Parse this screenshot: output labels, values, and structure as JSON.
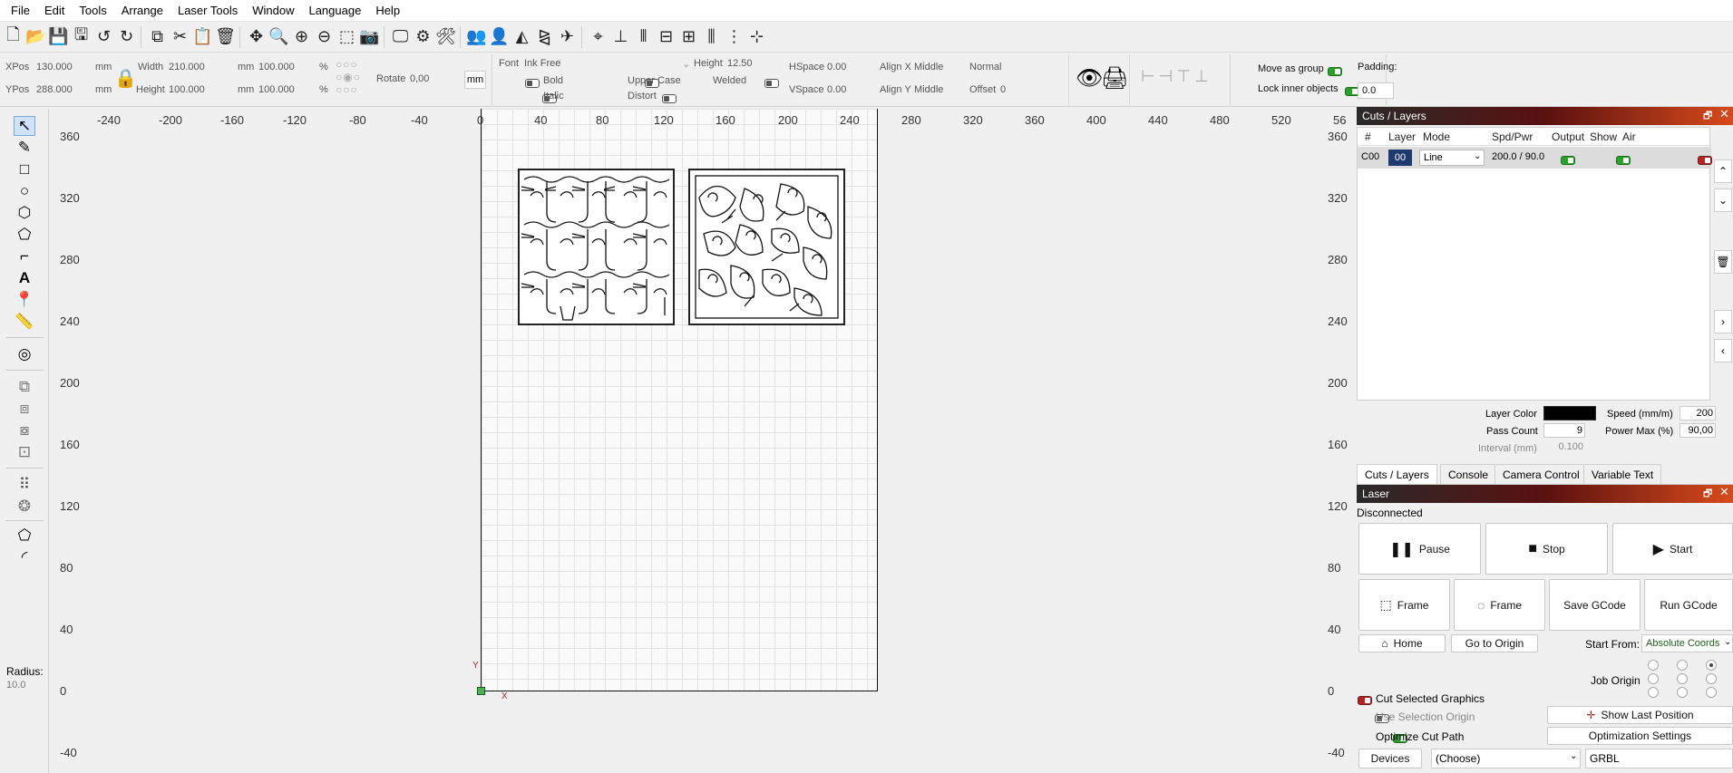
{
  "menu": [
    "File",
    "Edit",
    "Tools",
    "Arrange",
    "Laser Tools",
    "Window",
    "Language",
    "Help"
  ],
  "toolbar_icons": [
    "new-file-icon",
    "open-file-icon",
    "save-icon",
    "save-as-icon",
    "undo-icon",
    "redo-icon",
    "copy-icon",
    "cut-icon",
    "paste-icon",
    "delete-icon",
    "move-icon",
    "zoom-fit-icon",
    "zoom-in-icon",
    "zoom-out-icon",
    "select-frame-icon",
    "camera-icon",
    "monitor-icon",
    "settings-icon",
    "tools-icon",
    "group-icon",
    "user-icon",
    "mirror-icon",
    "flip-icon",
    "send-icon",
    "target-icon",
    "align-bottom-icon",
    "distribute-icon",
    "align-middle-icon",
    "align-center-icon",
    "distribute-h-icon",
    "distribute-v-icon",
    "grid-icon"
  ],
  "props": {
    "xpos_label": "XPos",
    "xpos": "130.000",
    "ypos_label": "YPos",
    "ypos": "288.000",
    "unit": "mm",
    "width_label": "Width",
    "width": "210.000",
    "height_label": "Height",
    "height": "100.000",
    "scale_w": "100.000",
    "scale_h": "100.000",
    "percent": "%",
    "rotate_label": "Rotate",
    "rotate": "0,00",
    "mm_button": "mm",
    "font_label": "Font",
    "font": "Ink Free",
    "font_height_label": "Height",
    "font_height": "12.50",
    "hspace_label": "HSpace",
    "hspace": "0.00",
    "vspace_label": "VSpace",
    "vspace": "0.00",
    "alignx_label": "Align X",
    "alignx": "Middle",
    "aligny_label": "Align Y",
    "aligny": "Middle",
    "normal": "Normal",
    "offset_label": "Offset",
    "offset": "0",
    "bold": "Bold",
    "italic": "Italic",
    "upper": "Upper Case",
    "distort": "Distort",
    "welded": "Welded",
    "move_group": "Move as group",
    "lock_inner": "Lock inner objects",
    "padding_label": "Padding:",
    "padding": "0.0"
  },
  "radius_label": "Radius:",
  "radius": "10.0",
  "ruler_x": [
    "-240",
    "-200",
    "-160",
    "-120",
    "-80",
    "-40",
    "0",
    "40",
    "80",
    "120",
    "160",
    "200",
    "240",
    "280",
    "320",
    "360",
    "400",
    "440",
    "480",
    "520",
    "56"
  ],
  "ruler_y": [
    "360",
    "320",
    "280",
    "240",
    "200",
    "160",
    "120",
    "80",
    "40",
    "0",
    "-40"
  ],
  "axis": {
    "y": "Y",
    "x": "X"
  },
  "cuts": {
    "title": "Cuts / Layers",
    "headers": [
      "#",
      "Layer",
      "Mode",
      "Spd/Pwr",
      "Output",
      "Show",
      "Air"
    ],
    "row": {
      "num": "C00",
      "layer": "00",
      "mode": "Line",
      "spdpwr": "200.0 / 90.0",
      "layer_color": "#1e3a6e"
    },
    "layer_color_label": "Layer Color",
    "layer_color": "#000000",
    "speed_label": "Speed (mm/m)",
    "speed": "200",
    "pass_label": "Pass Count",
    "pass": "9",
    "power_label": "Power Max (%)",
    "power": "90,00",
    "interval_label": "Interval (mm)",
    "interval": "0.100"
  },
  "tabs": [
    "Cuts / Layers",
    "Console",
    "Camera Control",
    "Variable Text"
  ],
  "laser": {
    "title": "Laser",
    "status": "Disconnected",
    "pause": "Pause",
    "stop": "Stop",
    "start": "Start",
    "frame1": "Frame",
    "frame2": "Frame",
    "save_gcode": "Save GCode",
    "run_gcode": "Run GCode",
    "home": "Home",
    "go_origin": "Go to Origin",
    "start_from_label": "Start From:",
    "start_from": "Absolute Coords",
    "job_origin": "Job Origin",
    "cut_selected": "Cut Selected Graphics",
    "use_selection": "Use Selection Origin",
    "optimize": "Optimize Cut Path",
    "show_last": "Show Last Position",
    "opt_settings": "Optimization Settings",
    "devices": "Devices",
    "choose": "(Choose)",
    "grbl": "GRBL"
  }
}
